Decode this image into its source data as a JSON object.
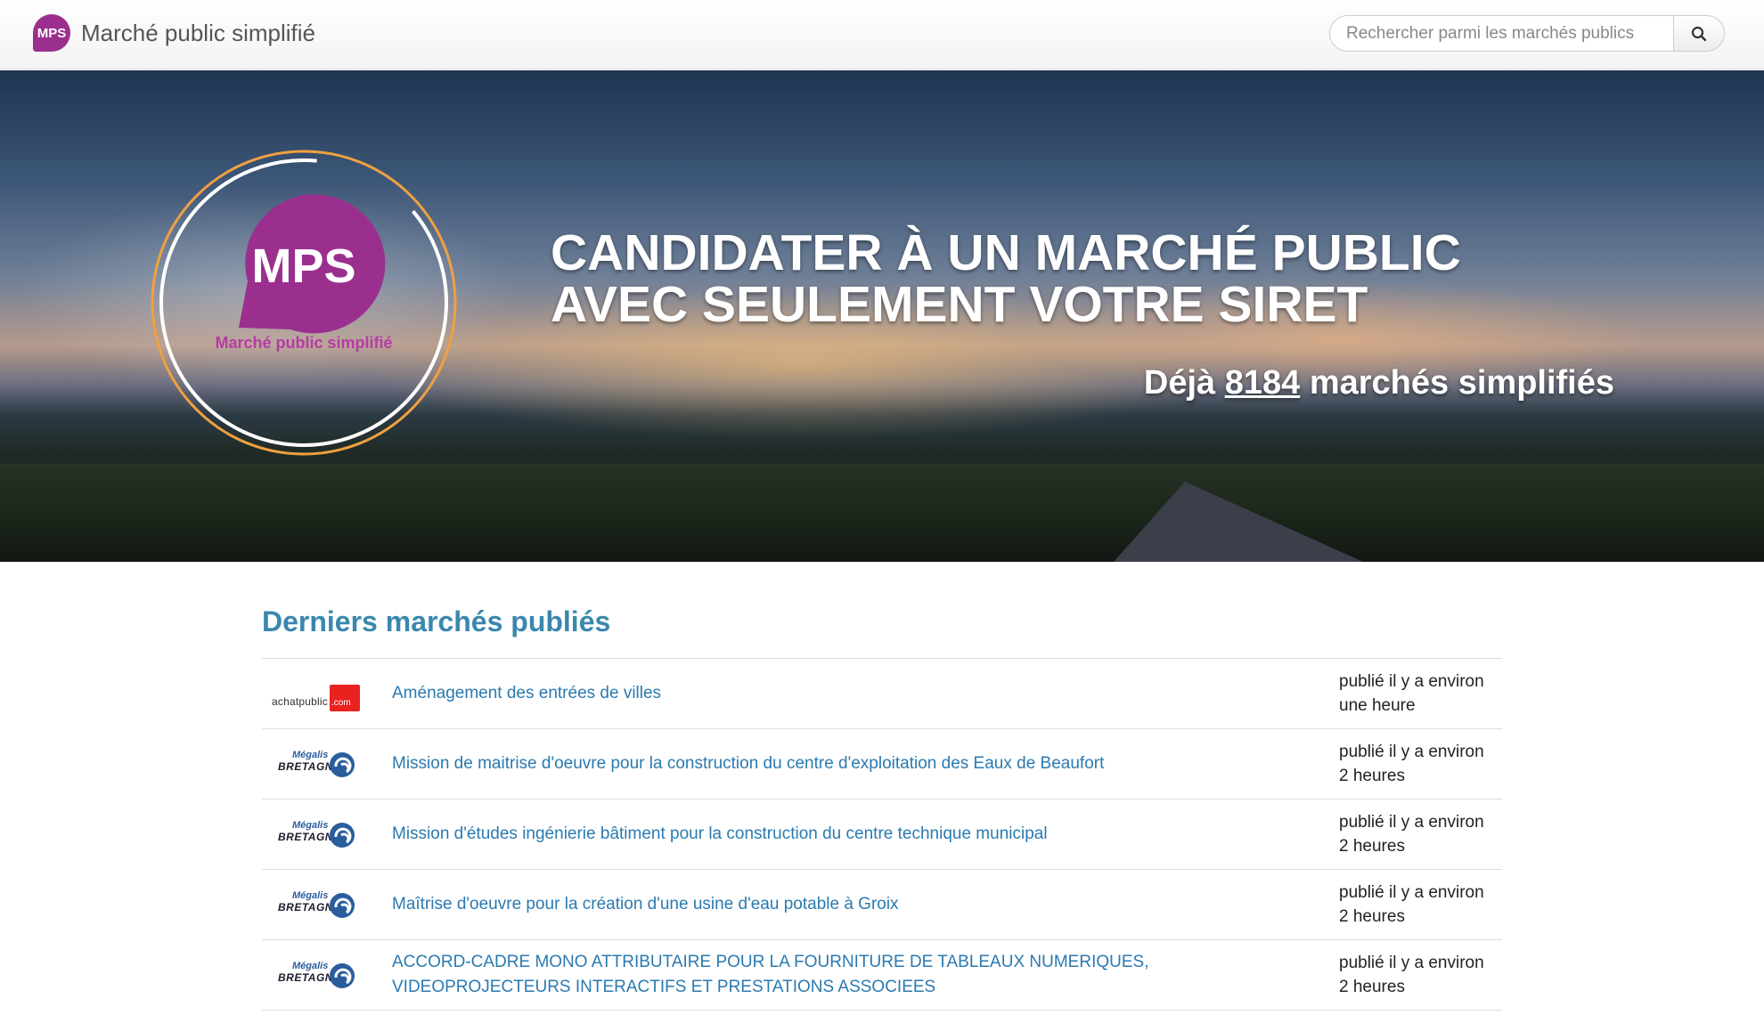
{
  "header": {
    "brand_logo_text": "MPS",
    "brand_name": "Marché public simplifié",
    "search_placeholder": "Rechercher parmi les marchés publics"
  },
  "hero": {
    "logo_text": "MPS",
    "logo_caption": "Marché public simplifié",
    "title_line1": "CANDIDATER À UN MARCHÉ PUBLIC",
    "title_line2": "AVEC SEULEMENT VOTRE SIRET",
    "count_prefix": "Déjà",
    "count_value": "8184",
    "count_suffix": "marchés simplifiés"
  },
  "section": {
    "title": "Derniers marchés publiés"
  },
  "markets": [
    {
      "source": "achatpublic.com",
      "source_label": "achatpublic",
      "source_suffix": ".com",
      "title_line1": "Aménagement des entrées de villes",
      "title_line2": "",
      "date_line1": "publié il y a environ",
      "date_line2": "une heure"
    },
    {
      "source": "megalis",
      "source_label": "Mégalis",
      "source_sub": "BRETAGNE",
      "title_line1": "Mission de maitrise d'oeuvre pour la construction du centre d'exploitation des Eaux de Beaufort",
      "title_line2": "",
      "date_line1": "publié il y a environ",
      "date_line2": "2 heures"
    },
    {
      "source": "megalis",
      "source_label": "Mégalis",
      "source_sub": "BRETAGNE",
      "title_line1": "Mission d'études ingénierie bâtiment pour la construction du centre technique municipal",
      "title_line2": "",
      "date_line1": "publié il y a environ",
      "date_line2": "2 heures"
    },
    {
      "source": "megalis",
      "source_label": "Mégalis",
      "source_sub": "BRETAGNE",
      "title_line1": "Maîtrise d'oeuvre pour la création d'une usine d'eau potable à Groix",
      "title_line2": "",
      "date_line1": "publié il y a environ",
      "date_line2": "2 heures"
    },
    {
      "source": "megalis",
      "source_label": "Mégalis",
      "source_sub": "BRETAGNE",
      "title_line1": "ACCORD-CADRE MONO ATTRIBUTAIRE POUR LA FOURNITURE DE TABLEAUX NUMERIQUES,",
      "title_line2": "VIDEOPROJECTEURS INTERACTIFS ET PRESTATIONS ASSOCIEES",
      "date_line1": "publié il y a environ",
      "date_line2": "2 heures"
    }
  ],
  "colors": {
    "brand_purple": "#9b2f8e",
    "link_blue": "#2a7ab0",
    "section_title": "#3a87ad",
    "achat_red": "#e8231f"
  },
  "icons": {
    "search": "search-icon",
    "megalis": "megalis-swirl-icon"
  }
}
